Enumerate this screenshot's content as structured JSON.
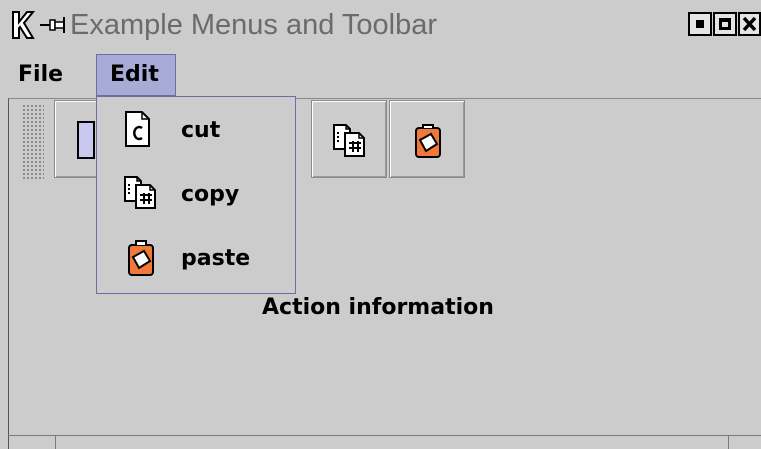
{
  "window": {
    "title": "Example Menus and Toolbar",
    "icons": [
      "kde-icon",
      "pin-icon"
    ],
    "controls": [
      "minimize-icon",
      "maximize-icon",
      "close-icon"
    ]
  },
  "menubar": {
    "file_label": "File",
    "edit_label": "Edit",
    "edit_selected": true
  },
  "edit_menu": {
    "items": [
      {
        "label": "cut",
        "icon": "cut-icon"
      },
      {
        "label": "copy",
        "icon": "copy-icon"
      },
      {
        "label": "paste",
        "icon": "paste-icon"
      }
    ]
  },
  "toolbar": {
    "buttons": [
      "cut-icon",
      "copy-icon",
      "paste-icon"
    ]
  },
  "content": {
    "action_info": "Action information"
  },
  "colors": {
    "background": "#cccccc",
    "menu_highlight": "#a7abd5",
    "menu_border": "#6b6fa5",
    "paste_orange": "#f07838"
  }
}
